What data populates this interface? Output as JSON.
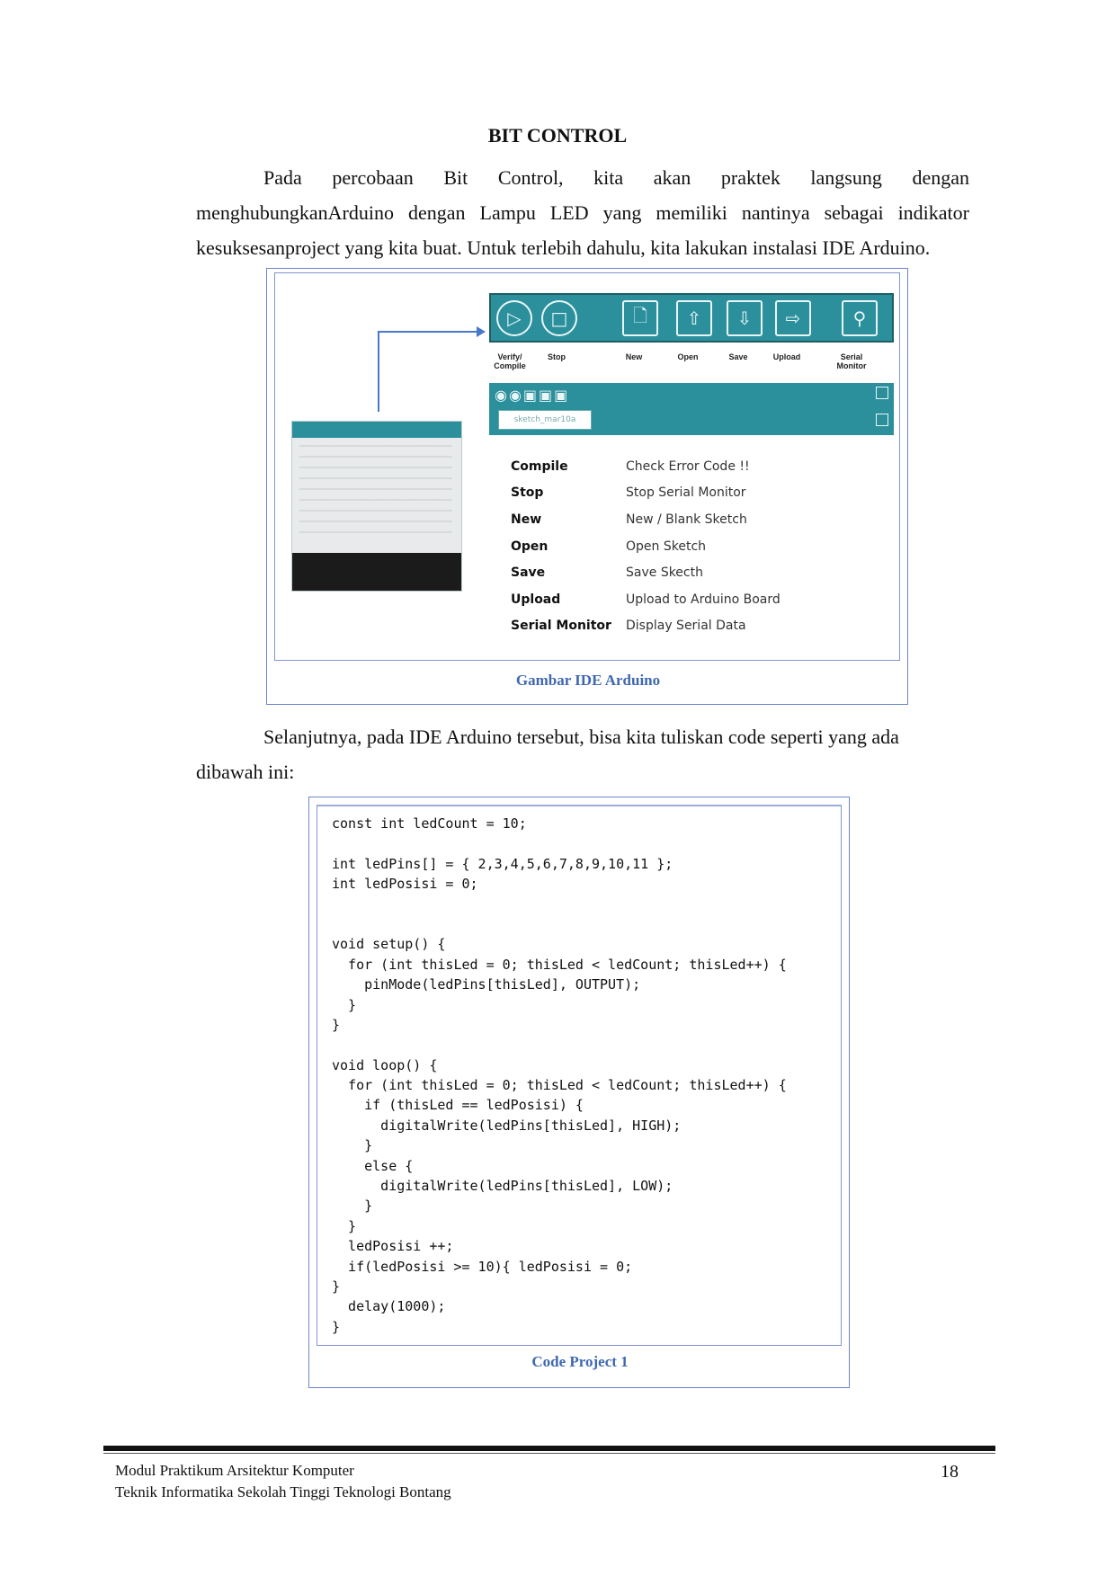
{
  "title": "BIT CONTROL",
  "intro_paragraph": "Pada percobaan Bit Control, kita akan praktek langsung dengan menghubungkanArduino dengan Lampu LED yang memiliki nantinya sebagai indikator kesuksesanproject yang kita buat. Untuk terlebih dahulu, kita lakukan instalasi IDE Arduino.",
  "figure1": {
    "toolbar_labels": [
      "Verify/ Compile",
      "Stop",
      "New",
      "Open",
      "Save",
      "Upload",
      "Serial Monitor"
    ],
    "sketch_tab": "sketch_mar10a",
    "legend": [
      {
        "key": "Compile",
        "value": "Check Error Code !!"
      },
      {
        "key": "Stop",
        "value": "Stop Serial Monitor"
      },
      {
        "key": "New",
        "value": "New / Blank Sketch"
      },
      {
        "key": "Open",
        "value": "Open Sketch"
      },
      {
        "key": "Save",
        "value": "Save Skecth"
      },
      {
        "key": "Upload",
        "value": "Upload to Arduino Board"
      },
      {
        "key": "Serial Monitor",
        "value": "Display Serial Data"
      }
    ],
    "caption": "Gambar IDE Arduino"
  },
  "second_paragraph": "Selanjutnya, pada IDE Arduino tersebut, bisa kita tuliskan code seperti yang ada dibawah ini:",
  "figure2": {
    "code_lines": [
      "const int ledCount = 10;",
      "",
      "int ledPins[] = { 2,3,4,5,6,7,8,9,10,11 };",
      "int ledPosisi = 0;",
      "",
      "",
      "void setup() {",
      "  for (int thisLed = 0; thisLed < ledCount; thisLed++) {",
      "    pinMode(ledPins[thisLed], OUTPUT);",
      "  }",
      "}",
      "",
      "void loop() {",
      "  for (int thisLed = 0; thisLed < ledCount; thisLed++) {",
      "    if (thisLed == ledPosisi) {",
      "      digitalWrite(ledPins[thisLed], HIGH);",
      "    }",
      "    else {",
      "      digitalWrite(ledPins[thisLed], LOW);",
      "    }",
      "  }",
      "  ledPosisi ++;",
      "  if(ledPosisi >= 10){ ledPosisi = 0;",
      "}",
      "  delay(1000);",
      "}"
    ],
    "caption": "Code Project 1"
  },
  "footer": {
    "line1": "Modul Praktikum Arsitektur Komputer",
    "line2": "Teknik Informatika Sekolah Tinggi Teknologi Bontang",
    "page_number": "18"
  }
}
